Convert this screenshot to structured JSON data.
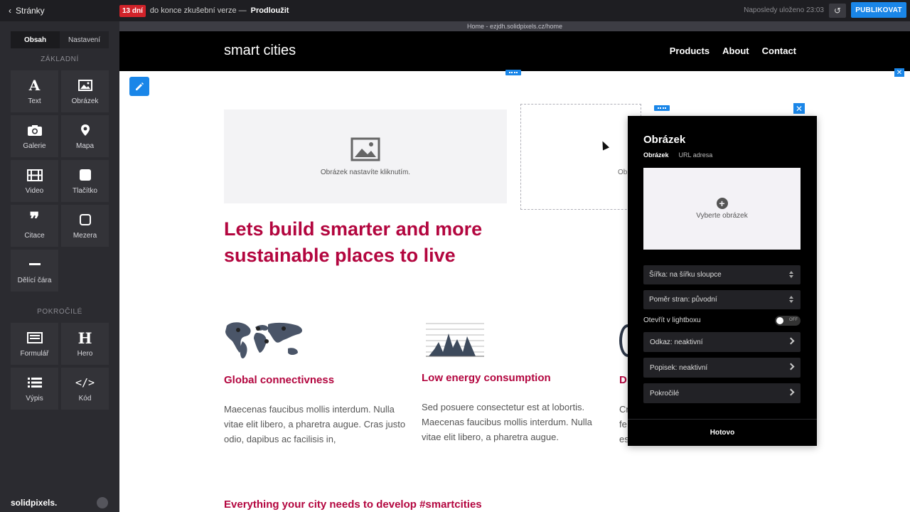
{
  "topbar": {
    "back_label": "Stránky",
    "trial_badge": "13 dní",
    "trial_text": "do konce zkušební verze —",
    "trial_link": "Prodloužit",
    "saved": "Naposledy uloženo 23:03",
    "publish": "PUBLIKOVAT"
  },
  "sidebar": {
    "tabs": [
      "Obsah",
      "Nastavení"
    ],
    "basic_title": "ZÁKLADNÍ",
    "basic": [
      "Text",
      "Obrázek",
      "Galerie",
      "Mapa",
      "Video",
      "Tlačítko",
      "Citace",
      "Mezera",
      "Dělící čára"
    ],
    "advanced_title": "POKROČILÉ",
    "advanced": [
      "Formulář",
      "Hero",
      "Výpis",
      "Kód"
    ],
    "brand": "solidpixels."
  },
  "urlbar": "Home - ezjdh.solidpixels.cz/home",
  "site": {
    "logo": "smart cities",
    "nav": [
      "Products",
      "About",
      "Contact"
    ]
  },
  "content": {
    "img_placeholder": "Obrázek nastavíte kliknutím.",
    "img_placeholder_partial": "Ob",
    "headline": "Lets build smarter and more sustainable places to live",
    "features": [
      {
        "title": "Global connectivness",
        "text": "Maecenas faucibus mollis interdum. Nulla vitae elit libero, a pharetra augue. Cras justo odio, dapibus ac facilisis in,"
      },
      {
        "title": "Low energy consumption",
        "text": "Sed posuere consectetur est at lobortis. Maecenas faucibus mollis interdum. Nulla vitae elit libero, a pharetra augue."
      },
      {
        "title": "D",
        "text": "Cr\nfe\nes"
      }
    ],
    "bottom_title": "Everything your city needs to develop #smartcities"
  },
  "panel": {
    "title": "Obrázek",
    "tabs": [
      "Obrázek",
      "URL adresa"
    ],
    "pick_label": "Vyberte obrázek",
    "width_select": "Šířka: na šířku sloupce",
    "ratio_select": "Poměr stran: původní",
    "lightbox_label": "Otevřít v lightboxu",
    "toggle_state": "OFF",
    "rows": [
      "Odkaz: neaktivní",
      "Popisek: neaktivní",
      "Pokročilé"
    ],
    "done": "Hotovo"
  },
  "colors": {
    "accent": "#1a86e8",
    "brand_red": "#b3063f",
    "trial_red": "#d2232a",
    "sidebar_bg": "#2b2b30"
  }
}
